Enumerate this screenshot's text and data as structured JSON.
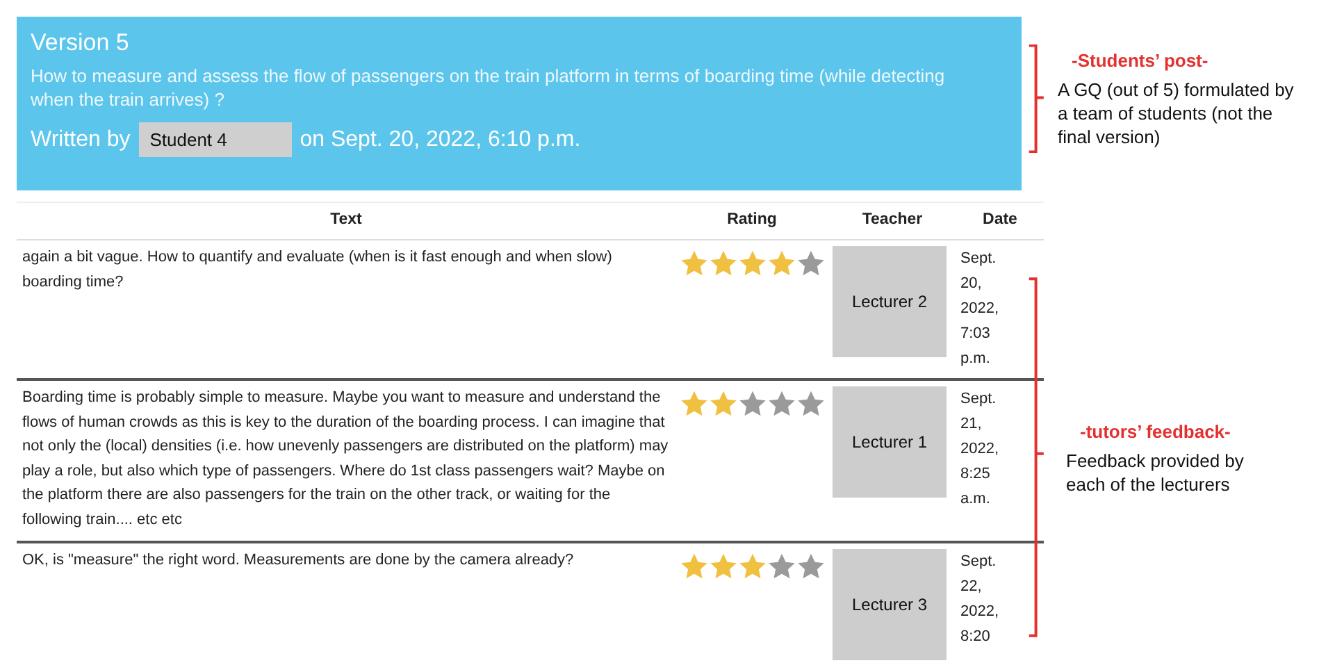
{
  "post": {
    "title": "Version 5",
    "question": "How to measure and assess the flow of passengers on the train platform in terms of boarding time (while detecting when the train arrives) ?",
    "written_by_label": "Written by",
    "author": "Student 4",
    "date": "on Sept. 20, 2022, 6:10 p.m."
  },
  "table": {
    "columns": [
      "Text",
      "Rating",
      "Teacher",
      "Date"
    ],
    "rows": [
      {
        "text": "again a bit vague. How to quantify and evaluate (when is it fast enough and when slow) boarding time?",
        "stars": 4,
        "teacher": "Lecturer 2",
        "date": "Sept. 20, 2022, 7:03 p.m."
      },
      {
        "text": "Boarding time is probably simple to measure. Maybe you want to measure and understand the flows of human crowds as this is key to the duration of the boarding process. I can imagine that not only the (local) densities (i.e. how unevenly passengers are distributed on the platform) may play a role, but also which type of passengers. Where do 1st class passengers wait? Maybe on the platform there are also passengers for the train on the other track, or waiting for the following train.... etc etc",
        "stars": 2,
        "teacher": "Lecturer 1",
        "date": "Sept. 21, 2022, 8:25 a.m."
      },
      {
        "text": "OK, is \"measure\" the right word. Measurements are done by the camera already?",
        "stars": 3,
        "teacher": "Lecturer 3",
        "date": "Sept. 22, 2022, 8:20"
      }
    ]
  },
  "annotations": [
    {
      "title": "-Students’ post-",
      "body": "A GQ (out of 5) formulated by a team of students (not the final version)"
    },
    {
      "title": "-tutors’ feedback-",
      "body": "Feedback provided by each of the lecturers"
    }
  ]
}
